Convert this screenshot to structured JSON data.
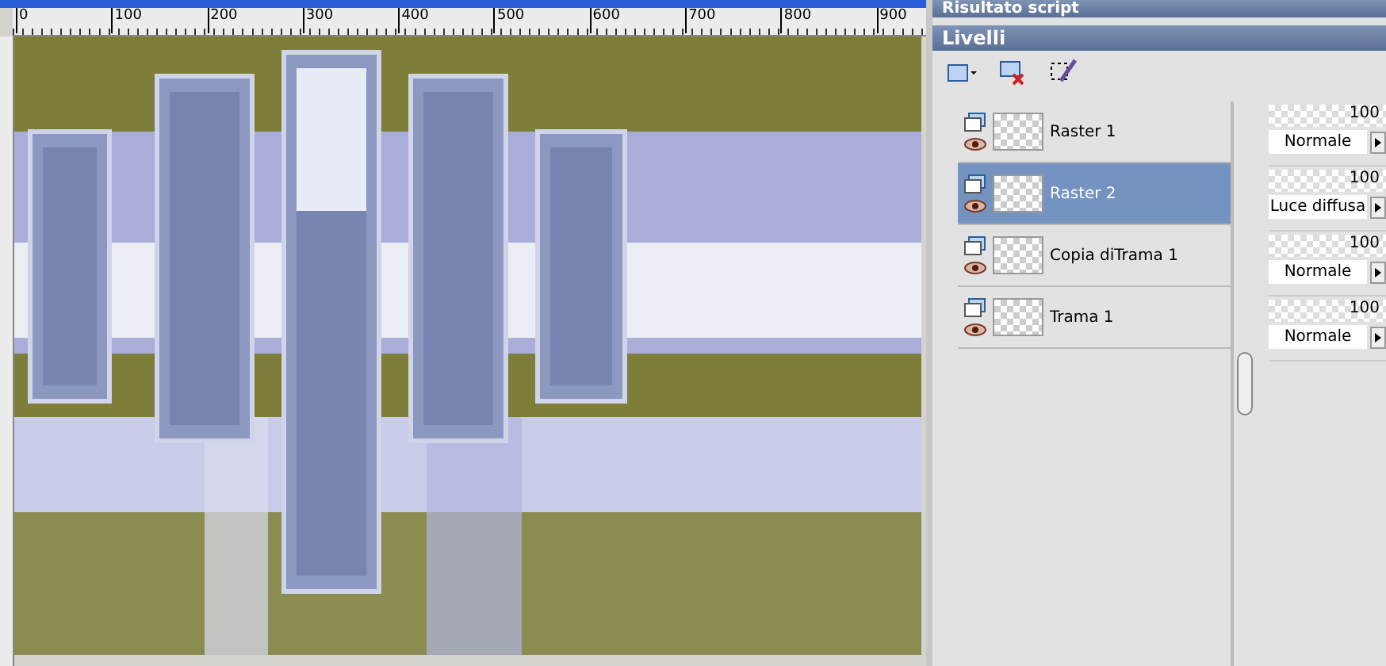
{
  "ruler": {
    "labels": [
      "0",
      "100",
      "200",
      "300",
      "400",
      "500",
      "600",
      "700",
      "800",
      "900"
    ]
  },
  "script_panel": {
    "title": "Risultato script"
  },
  "layers_panel": {
    "title": "Livelli",
    "layers": [
      {
        "name": "Raster 1",
        "selected": false,
        "opacity": "100",
        "blend": "Normale"
      },
      {
        "name": "Raster 2",
        "selected": true,
        "opacity": "100",
        "blend": "Luce diffusa"
      },
      {
        "name": "Copia diTrama 1",
        "selected": false,
        "opacity": "100",
        "blend": "Normale"
      },
      {
        "name": "Trama 1",
        "selected": false,
        "opacity": "100",
        "blend": "Normale"
      }
    ]
  }
}
